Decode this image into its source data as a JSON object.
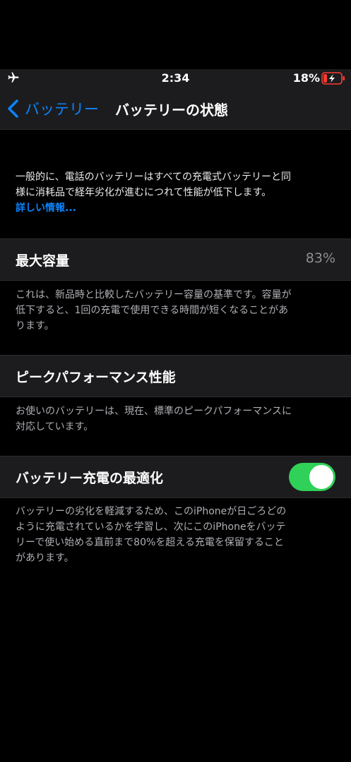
{
  "status_bar": {
    "time": "2:34",
    "battery_percent": "18%",
    "airplane_icon": "airplane-icon",
    "battery_icon": "battery-charging-icon"
  },
  "nav": {
    "back_label": "バッテリー",
    "title": "バッテリーの状態"
  },
  "intro": {
    "line1": "一般的に、電話のバッテリーはすべての充電式バッテリーと同",
    "line2": "様に消耗品で経年劣化が進むにつれて性能が低下します。",
    "link": "詳しい情報..."
  },
  "max_capacity": {
    "label": "最大容量",
    "value": "83%",
    "footer_line1": "これは、新品時と比較したバッテリー容量の基準です。容量が",
    "footer_line2": "低下すると、1回の充電で使用できる時間が短くなることがあ",
    "footer_line3": "ります。"
  },
  "peak_performance": {
    "label": "ピークパフォーマンス性能",
    "footer_line1": "お使いのバッテリーは、現在、標準のピークパフォーマンスに",
    "footer_line2": "対応しています。"
  },
  "optimized_charging": {
    "label": "バッテリー充電の最適化",
    "enabled": true,
    "footer_line1": "バッテリーの劣化を軽減するため、このiPhoneが日ごろどの",
    "footer_line2": "ように充電されているかを学習し、次にこのiPhoneをバッテ",
    "footer_line3": "リーで使い始める直前まで80%を超える充電を保留すること",
    "footer_line4": "があります。"
  },
  "colors": {
    "accent": "#0a84ff",
    "toggle_on": "#30d158",
    "cell_bg": "#1c1c1e",
    "battery_low": "#ff3b30"
  }
}
